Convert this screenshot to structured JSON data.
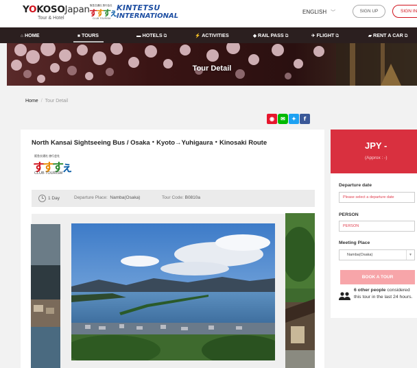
{
  "header": {
    "logo_o": "O",
    "logo_brand_rest": "KOSO",
    "logo_japan": "Japan",
    "logo_sub": "Tour & Hotel",
    "club_small_tiny": "阪急交通社 旅行会社",
    "club_small_glyphs": [
      "す",
      "す",
      "す",
      "ぇ"
    ],
    "club_small_sub": "CLUB TOURISM",
    "kintetsu_line1": "KINTETSU",
    "kintetsu_line2": "INTERNATIONAL",
    "language": "ENGLISH",
    "signup_label": "SIGN UP",
    "signin_label": "SIGN IN"
  },
  "nav": {
    "items": [
      {
        "label": "HOME",
        "icon": "home-icon"
      },
      {
        "label": "TOURS",
        "icon": "suitcase-icon"
      },
      {
        "label": "HOTELS",
        "icon": "bed-icon"
      },
      {
        "label": "ACTIVITIES",
        "icon": "bolt-icon"
      },
      {
        "label": "RAIL PASS",
        "icon": "ticket-icon"
      },
      {
        "label": "FLIGHT",
        "icon": "plane-icon"
      },
      {
        "label": "RENT A CAR",
        "icon": "car-icon"
      }
    ]
  },
  "hero": {
    "title": "Tour Detail"
  },
  "breadcrumb": {
    "home": "Home",
    "separator": "/",
    "current": "Tour Detail"
  },
  "social": {
    "colors": {
      "weibo": "#e6162d",
      "line": "#00b900",
      "twitter": "#1da1f2",
      "facebook": "#3b5998"
    }
  },
  "tour": {
    "title": "North Kansai Sightseeing Bus / Osaka・Kyoto→Yuhigaura・Kinosaki Route",
    "club_logo_tiny": "阪急交通社 旅行会社",
    "club_logo_glyphs": [
      "す",
      "す",
      "す",
      "ぇ"
    ],
    "club_logo_sub": "CLUB TOURISM",
    "duration": "1 Day",
    "departure_label": "Departure Place:",
    "departure_value": "Namba(Osaka)",
    "code_label": "Tour Code:",
    "code_value": "B0810a"
  },
  "booking": {
    "currency": "JPY -",
    "approx": "(Approx : -)",
    "departure_date_label": "Departure date",
    "departure_date_placeholder": "Please select a departure date",
    "person_label": "PERSON",
    "person_value": "PERSON",
    "meeting_place_label": "Meeting Place",
    "meeting_place_value": "Namba(Osaka)",
    "book_button": "BOOK A TOUR",
    "people_count": "6",
    "people_bold": "other people",
    "people_rest": "considered this tour in the last 24 hours.",
    "price_color": "#d9303f",
    "book_color": "#f7a5a9"
  }
}
